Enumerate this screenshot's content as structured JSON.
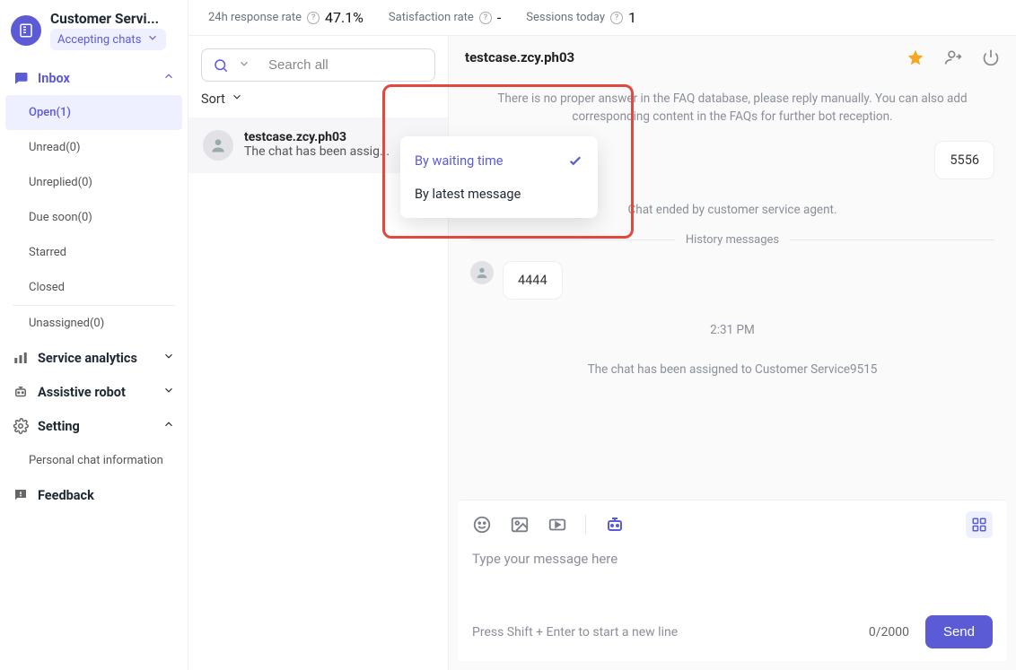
{
  "brand": {
    "title": "Customer Servi...",
    "status_label": "Accepting chats"
  },
  "sidebar": {
    "inbox_label": "Inbox",
    "items": [
      {
        "label": "Open(1)",
        "active": true
      },
      {
        "label": "Unread(0)"
      },
      {
        "label": "Unreplied(0)"
      },
      {
        "label": "Due soon(0)"
      },
      {
        "label": "Starred"
      },
      {
        "label": "Closed"
      },
      {
        "label": "Unassigned(0)"
      }
    ],
    "analytics_label": "Service analytics",
    "robot_label": "Assistive robot",
    "setting_label": "Setting",
    "personal_label": "Personal chat information",
    "feedback_label": "Feedback"
  },
  "topbar": {
    "response_label": "24h response rate",
    "response_value": "47.1%",
    "satisfaction_label": "Satisfaction rate",
    "satisfaction_value": "-",
    "sessions_label": "Sessions today",
    "sessions_value": "1"
  },
  "search": {
    "placeholder": "Search all"
  },
  "sort": {
    "label": "Sort",
    "options": [
      {
        "label": "By waiting time",
        "selected": true
      },
      {
        "label": "By latest message",
        "selected": false
      }
    ]
  },
  "chat_list": [
    {
      "name": "testcase.zcy.ph03",
      "last": "The chat has been assig..."
    }
  ],
  "chat": {
    "title": "testcase.zcy.ph03",
    "faq_notice": "There is no proper answer in the FAQ database, please reply manually. You can also add corresponding content in the FAQs for further bot reception.",
    "msg_5556": "5556",
    "ended_text": "Chat ended by customer service agent.",
    "history_label": "History messages",
    "msg_4444": "4444",
    "timestamp": "2:31 PM",
    "assigned_text": "The chat has been assigned to Customer Service9515"
  },
  "composer": {
    "placeholder": "Type your message here",
    "hint": "Press Shift + Enter to start a new line",
    "counter": "0/2000",
    "send_label": "Send"
  }
}
